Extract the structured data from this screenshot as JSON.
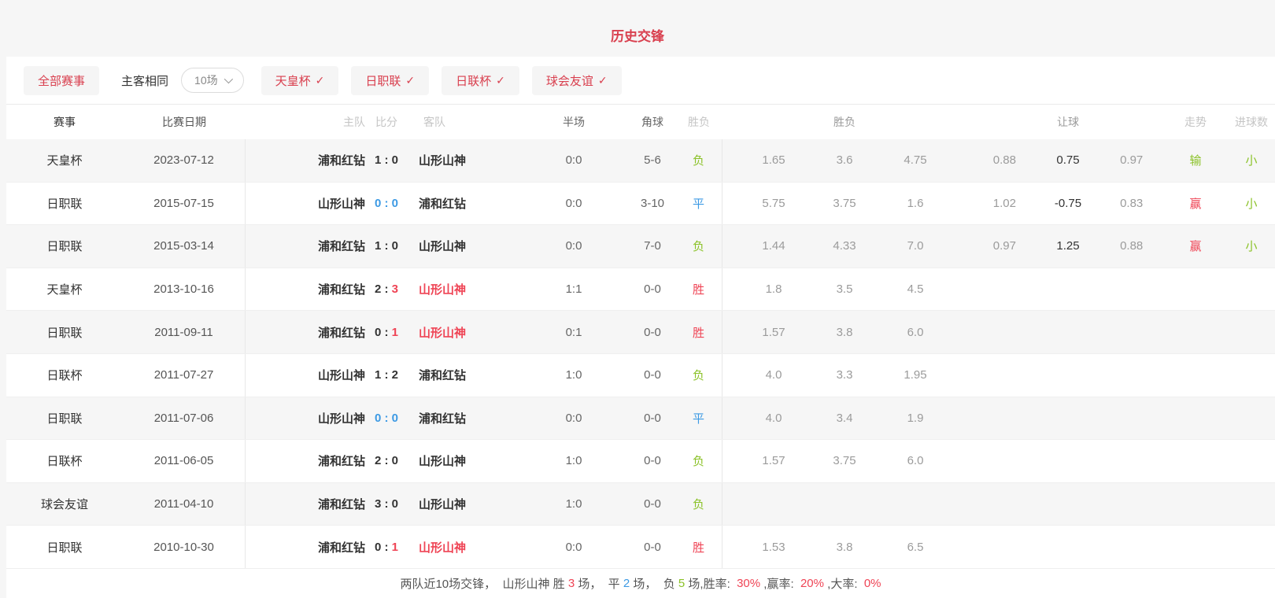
{
  "page": {
    "title": "历史交锋"
  },
  "colors": {
    "accent_red": "#d9404f",
    "win_red": "#ef4455",
    "loss_green": "#8bc228",
    "draw_blue": "#3d9ae4",
    "text_dark": "#333333"
  },
  "filters": {
    "all_label": "全部赛事",
    "same_venue_label": "主客相同",
    "count_select": {
      "value": "10场"
    },
    "check_glyph": "✓",
    "toggles": [
      {
        "label": "天皇杯"
      },
      {
        "label": "日职联"
      },
      {
        "label": "日联杯"
      },
      {
        "label": "球会友谊"
      }
    ]
  },
  "table": {
    "headers": [
      "赛事",
      "比赛日期",
      "主队",
      "比分",
      "客队",
      "半场",
      "角球",
      "胜负",
      "胜负",
      "让球",
      "走势",
      "进球数"
    ],
    "rows": [
      {
        "league": "天皇杯",
        "date": "2023-07-12",
        "home": "浦和红钻",
        "score_home": "1",
        "score_away": "0",
        "score_style": "normal",
        "away": "山形山神",
        "away_red": false,
        "half": "0:0",
        "corner": "5-6",
        "result": "负",
        "result_type": "loss",
        "odds": [
          "1.65",
          "3.6",
          "4.75"
        ],
        "handicap": [
          "0.88",
          "0.75",
          "0.97"
        ],
        "trend": "输",
        "trend_type": "loss",
        "goals": "小",
        "goals_type": "loss"
      },
      {
        "league": "日职联",
        "date": "2015-07-15",
        "home": "山形山神",
        "score_home": "0",
        "score_away": "0",
        "score_style": "draw",
        "away": "浦和红钻",
        "away_red": false,
        "half": "0:0",
        "corner": "3-10",
        "result": "平",
        "result_type": "draw",
        "odds": [
          "5.75",
          "3.75",
          "1.6"
        ],
        "handicap": [
          "1.02",
          "-0.75",
          "0.83"
        ],
        "trend": "赢",
        "trend_type": "win",
        "goals": "小",
        "goals_type": "loss"
      },
      {
        "league": "日职联",
        "date": "2015-03-14",
        "home": "浦和红钻",
        "score_home": "1",
        "score_away": "0",
        "score_style": "normal",
        "away": "山形山神",
        "away_red": false,
        "half": "0:0",
        "corner": "7-0",
        "result": "负",
        "result_type": "loss",
        "odds": [
          "1.44",
          "4.33",
          "7.0"
        ],
        "handicap": [
          "0.97",
          "1.25",
          "0.88"
        ],
        "trend": "赢",
        "trend_type": "win",
        "goals": "小",
        "goals_type": "loss"
      },
      {
        "league": "天皇杯",
        "date": "2013-10-16",
        "home": "浦和红钻",
        "score_home": "2",
        "score_away": "3",
        "score_style": "away_red",
        "away": "山形山神",
        "away_red": true,
        "half": "1:1",
        "corner": "0-0",
        "result": "胜",
        "result_type": "win",
        "odds": [
          "1.8",
          "3.5",
          "4.5"
        ],
        "handicap": [
          "",
          "",
          ""
        ],
        "trend": "",
        "trend_type": "",
        "goals": "",
        "goals_type": ""
      },
      {
        "league": "日职联",
        "date": "2011-09-11",
        "home": "浦和红钻",
        "score_home": "0",
        "score_away": "1",
        "score_style": "away_red",
        "away": "山形山神",
        "away_red": true,
        "half": "0:1",
        "corner": "0-0",
        "result": "胜",
        "result_type": "win",
        "odds": [
          "1.57",
          "3.8",
          "6.0"
        ],
        "handicap": [
          "",
          "",
          ""
        ],
        "trend": "",
        "trend_type": "",
        "goals": "",
        "goals_type": ""
      },
      {
        "league": "日联杯",
        "date": "2011-07-27",
        "home": "山形山神",
        "score_home": "1",
        "score_away": "2",
        "score_style": "normal",
        "away": "浦和红钻",
        "away_red": false,
        "half": "1:0",
        "corner": "0-0",
        "result": "负",
        "result_type": "loss",
        "odds": [
          "4.0",
          "3.3",
          "1.95"
        ],
        "handicap": [
          "",
          "",
          ""
        ],
        "trend": "",
        "trend_type": "",
        "goals": "",
        "goals_type": ""
      },
      {
        "league": "日职联",
        "date": "2011-07-06",
        "home": "山形山神",
        "score_home": "0",
        "score_away": "0",
        "score_style": "draw",
        "away": "浦和红钻",
        "away_red": false,
        "half": "0:0",
        "corner": "0-0",
        "result": "平",
        "result_type": "draw",
        "odds": [
          "4.0",
          "3.4",
          "1.9"
        ],
        "handicap": [
          "",
          "",
          ""
        ],
        "trend": "",
        "trend_type": "",
        "goals": "",
        "goals_type": ""
      },
      {
        "league": "日联杯",
        "date": "2011-06-05",
        "home": "浦和红钻",
        "score_home": "2",
        "score_away": "0",
        "score_style": "normal",
        "away": "山形山神",
        "away_red": false,
        "half": "1:0",
        "corner": "0-0",
        "result": "负",
        "result_type": "loss",
        "odds": [
          "1.57",
          "3.75",
          "6.0"
        ],
        "handicap": [
          "",
          "",
          ""
        ],
        "trend": "",
        "trend_type": "",
        "goals": "",
        "goals_type": ""
      },
      {
        "league": "球会友谊",
        "date": "2011-04-10",
        "home": "浦和红钻",
        "score_home": "3",
        "score_away": "0",
        "score_style": "normal",
        "away": "山形山神",
        "away_red": false,
        "half": "1:0",
        "corner": "0-0",
        "result": "负",
        "result_type": "loss",
        "odds": [
          "",
          "",
          ""
        ],
        "handicap": [
          "",
          "",
          ""
        ],
        "trend": "",
        "trend_type": "",
        "goals": "",
        "goals_type": ""
      },
      {
        "league": "日职联",
        "date": "2010-10-30",
        "home": "浦和红钻",
        "score_home": "0",
        "score_away": "1",
        "score_style": "away_red",
        "away": "山形山神",
        "away_red": true,
        "half": "0:0",
        "corner": "0-0",
        "result": "胜",
        "result_type": "win",
        "odds": [
          "1.53",
          "3.8",
          "6.5"
        ],
        "handicap": [
          "",
          "",
          ""
        ],
        "trend": "",
        "trend_type": "",
        "goals": "",
        "goals_type": ""
      }
    ]
  },
  "summary": {
    "segments": [
      {
        "text": "两队近10场交锋，  山形山神 胜 ",
        "color": "text"
      },
      {
        "text": "3",
        "color": "red"
      },
      {
        "text": " 场，  平 ",
        "color": "text"
      },
      {
        "text": "2",
        "color": "blue"
      },
      {
        "text": " 场，  负 ",
        "color": "text"
      },
      {
        "text": "5",
        "color": "green"
      },
      {
        "text": " 场,胜率:  ",
        "color": "text"
      },
      {
        "text": "30%",
        "color": "red"
      },
      {
        "text": " ,赢率:  ",
        "color": "text"
      },
      {
        "text": "20%",
        "color": "red"
      },
      {
        "text": " ,大率:  ",
        "color": "text"
      },
      {
        "text": "0%",
        "color": "red"
      }
    ]
  }
}
